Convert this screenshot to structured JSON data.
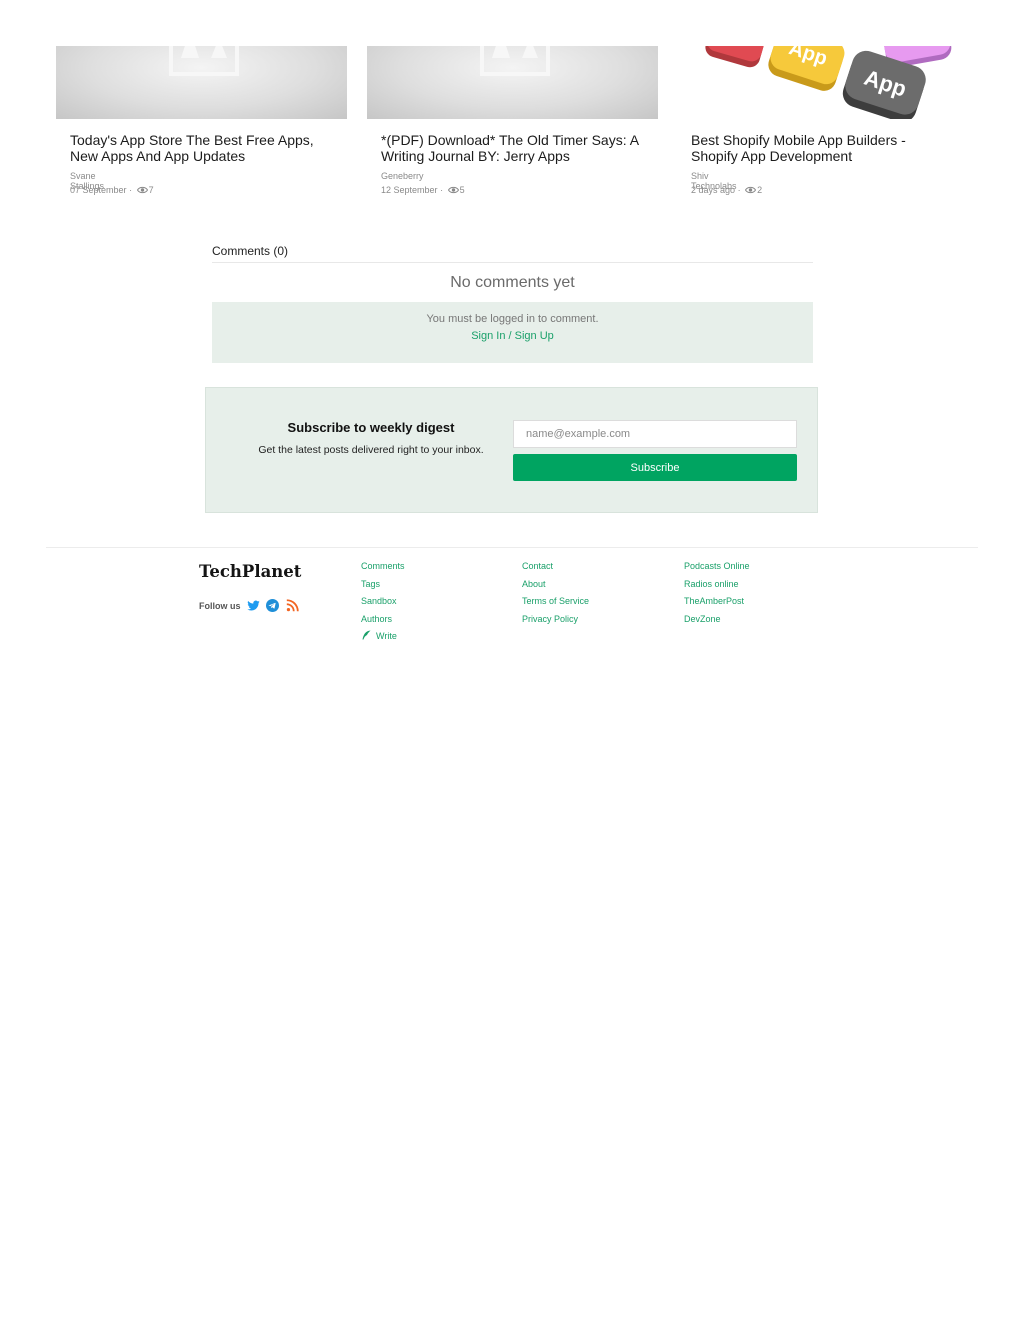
{
  "related": [
    {
      "title": "Today's App Store The Best Free Apps, New Apps And App Updates",
      "author": "Svane Stallings",
      "date": "07 September",
      "views": "7",
      "image": "placeholder-image"
    },
    {
      "title": "*(PDF) Download* The Old Timer Says: A Writing Journal BY: Jerry Apps",
      "author": "Geneberry",
      "date": "12 September",
      "views": "5",
      "image": "placeholder-image"
    },
    {
      "title": "Best Shopify Mobile App Builders - Shopify App Development",
      "author": "Shiv Technolabs",
      "date": "2 days ago",
      "views": "2",
      "image": "app-buttons-image",
      "image_text": "App"
    }
  ],
  "meta_separator": "·",
  "comments": {
    "heading": "Comments (0)",
    "empty": "No comments yet",
    "login_msg": "You must be logged in to comment.",
    "signin": "Sign In / Sign Up"
  },
  "subscribe": {
    "title": "Subscribe to weekly digest",
    "desc": "Get the latest posts delivered right to your inbox.",
    "placeholder": "name@example.com",
    "button": "Subscribe"
  },
  "footer": {
    "brand": "TechPlanet",
    "follow": "Follow us",
    "social": [
      "twitter-icon",
      "telegram-icon",
      "rss-icon"
    ],
    "col1": [
      "Comments",
      "Tags",
      "Sandbox",
      "Authors",
      "Write"
    ],
    "col2": [
      "Contact",
      "About",
      "Terms of Service",
      "Privacy Policy"
    ],
    "col3": [
      "Podcasts Online",
      "Radios online",
      "TheAmberPost",
      "DevZone"
    ]
  },
  "colors": {
    "accent": "#00a461",
    "link": "#1aa06a",
    "panel": "#e7efea"
  }
}
